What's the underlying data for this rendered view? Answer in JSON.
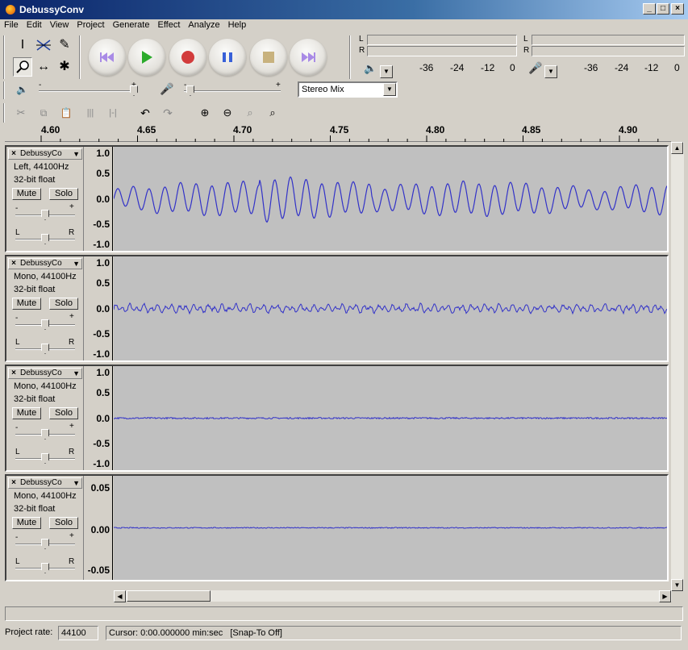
{
  "window": {
    "title": "DebussyConv"
  },
  "menu": [
    "File",
    "Edit",
    "View",
    "Project",
    "Generate",
    "Effect",
    "Analyze",
    "Help"
  ],
  "meters": {
    "output": {
      "channels": [
        "L",
        "R"
      ],
      "scale": [
        "-36",
        "-24",
        "-12",
        "0"
      ]
    },
    "input": {
      "channels": [
        "L",
        "R"
      ],
      "scale": [
        "-36",
        "-24",
        "-12",
        "0"
      ]
    }
  },
  "mixer": {
    "output_slider_marks": [
      "-",
      "+"
    ],
    "input_slider_marks": [
      "-",
      "+"
    ],
    "input_source": "Stereo Mix"
  },
  "ruler": {
    "labels": [
      "4.60",
      "4.65",
      "4.70",
      "4.75",
      "4.80",
      "4.85",
      "4.90"
    ]
  },
  "tracks": [
    {
      "name": "DebussyCo",
      "info1": "Left, 44100Hz",
      "info2": "32-bit float",
      "mute": "Mute",
      "solo": "Solo",
      "gain_marks": [
        "-",
        "+"
      ],
      "pan_marks": [
        "L",
        "R"
      ],
      "scale": [
        "1.0",
        "0.5",
        "0.0",
        "-0.5",
        "-1.0"
      ]
    },
    {
      "name": "DebussyCo",
      "info1": "Mono, 44100Hz",
      "info2": "32-bit float",
      "mute": "Mute",
      "solo": "Solo",
      "gain_marks": [
        "-",
        "+"
      ],
      "pan_marks": [
        "L",
        "R"
      ],
      "scale": [
        "1.0",
        "0.5",
        "0.0",
        "-0.5",
        "-1.0"
      ]
    },
    {
      "name": "DebussyCo",
      "info1": "Mono, 44100Hz",
      "info2": "32-bit float",
      "mute": "Mute",
      "solo": "Solo",
      "gain_marks": [
        "-",
        "+"
      ],
      "pan_marks": [
        "L",
        "R"
      ],
      "scale": [
        "1.0",
        "0.5",
        "0.0",
        "-0.5",
        "-1.0"
      ]
    },
    {
      "name": "DebussyCo",
      "info1": "Mono, 44100Hz",
      "info2": "32-bit float",
      "mute": "Mute",
      "solo": "Solo",
      "gain_marks": [
        "-",
        "+"
      ],
      "pan_marks": [
        "L",
        "R"
      ],
      "scale": [
        "0.05",
        "0.00",
        "-0.05"
      ]
    }
  ],
  "status": {
    "project_rate_label": "Project rate:",
    "project_rate": "44100",
    "cursor": "Cursor: 0:00.000000 min:sec",
    "snap": "[Snap-To Off]"
  },
  "colors": {
    "waveform": "#3232c8",
    "title_bar": "#0a246a",
    "wave_bg": "#c0c0c0"
  }
}
